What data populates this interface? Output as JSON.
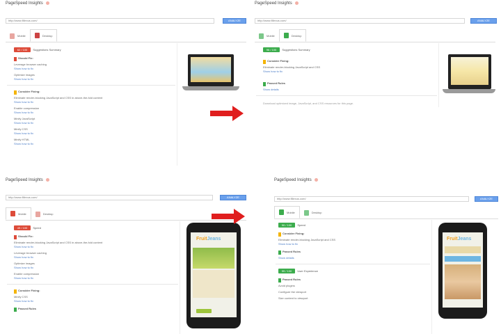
{
  "colors": {
    "red_badge": "#dd4b39",
    "green_badge": "#3cac4d",
    "warning": "#f4b400",
    "arrow": "#e01e1e",
    "analyze_button": "#6aa0ec"
  },
  "panels": [
    {
      "title": "PageSpeed Insights",
      "url": "http://www.fillexus.com/",
      "analyze_label": "ANALYZE",
      "tabs": [
        {
          "label": "Mobile"
        },
        {
          "label": "Desktop"
        }
      ],
      "active_tab": 1,
      "score": "62 / 100",
      "score_label": "Suggestions Summary",
      "sections": [
        {
          "status": "red",
          "heading": "Should Fix:",
          "items": [
            {
              "text": "Leverage browser caching",
              "link": "Show how to fix"
            },
            {
              "text": "Optimize images",
              "link": "Show how to fix"
            }
          ]
        },
        {
          "status": "yellow",
          "heading": "Consider Fixing:",
          "items": [
            {
              "text": "Eliminate render-blocking JavaScript and CSS in above-the-fold content",
              "link": "Show how to fix"
            },
            {
              "text": "Enable compression",
              "link": "Show how to fix"
            },
            {
              "text": "Minify JavaScript",
              "link": "Show how to fix"
            },
            {
              "text": "Minify CSS",
              "link": "Show how to fix"
            },
            {
              "text": "Minify HTML",
              "link": "Show how to fix"
            }
          ]
        }
      ]
    },
    {
      "title": "PageSpeed Insights",
      "url": "http://www.fillexus.com/",
      "analyze_label": "ANALYZE",
      "tabs": [
        {
          "label": "Mobile"
        },
        {
          "label": "Desktop"
        }
      ],
      "active_tab": 1,
      "score": "96 / 100",
      "score_label": "Suggestions Summary",
      "sections": [
        {
          "status": "yellow",
          "heading": "Consider Fixing:",
          "items": [
            {
              "text": "Eliminate render-blocking JavaScript and CSS",
              "link": "Show how to fix"
            }
          ]
        },
        {
          "status": "green",
          "heading": "Passed Rules",
          "items": [
            {
              "text": "",
              "link": "Show details"
            }
          ]
        }
      ],
      "footnote": "Download optimized image, JavaScript, and CSS resources for this page."
    },
    {
      "title": "PageSpeed Insights",
      "url": "http://www.fillexus.com/",
      "analyze_label": "ANALYZE",
      "tabs": [
        {
          "label": "Mobile"
        },
        {
          "label": "Desktop"
        }
      ],
      "active_tab": 0,
      "score": "49 / 100",
      "score_label": "Speed",
      "sections": [
        {
          "status": "red",
          "heading": "Should Fix:",
          "items": [
            {
              "text": "Eliminate render-blocking JavaScript and CSS in above-the-fold content",
              "link": "Show how to fix"
            },
            {
              "text": "Leverage browser caching",
              "link": "Show how to fix"
            },
            {
              "text": "Optimize images",
              "link": "Show how to fix"
            },
            {
              "text": "Enable compression",
              "link": "Show how to fix"
            }
          ]
        },
        {
          "status": "yellow",
          "heading": "Consider Fixing:",
          "items": [
            {
              "text": "Minify CSS",
              "link": "Show how to fix"
            }
          ]
        },
        {
          "status": "green",
          "heading": "Passed Rules",
          "items": []
        }
      ]
    },
    {
      "title": "PageSpeed Insights",
      "url": "http://www.fillexus.com/",
      "analyze_label": "ANALYZE",
      "tabs": [
        {
          "label": "Mobile"
        },
        {
          "label": "Desktop"
        }
      ],
      "active_tab": 0,
      "score": "90 / 100",
      "score_label": "Speed",
      "sections": [
        {
          "status": "yellow",
          "heading": "Consider Fixing:",
          "items": [
            {
              "text": "Eliminate render-blocking JavaScript and CSS",
              "link": "Show how to fix"
            }
          ]
        },
        {
          "status": "green",
          "heading": "Passed Rules",
          "items": [
            {
              "text": "",
              "link": "Show details"
            }
          ]
        }
      ],
      "extra_score": "99 / 100",
      "extra_label": "User Experience",
      "extra_section": {
        "status": "green",
        "heading": "Passed Rules",
        "items": [
          {
            "text": "Avoid plugins",
            "link": ""
          },
          {
            "text": "Configure the viewport",
            "link": ""
          },
          {
            "text": "Size content to viewport",
            "link": ""
          }
        ]
      }
    }
  ],
  "phone_logo": {
    "left": "Fruit",
    "right": "Jeans"
  }
}
